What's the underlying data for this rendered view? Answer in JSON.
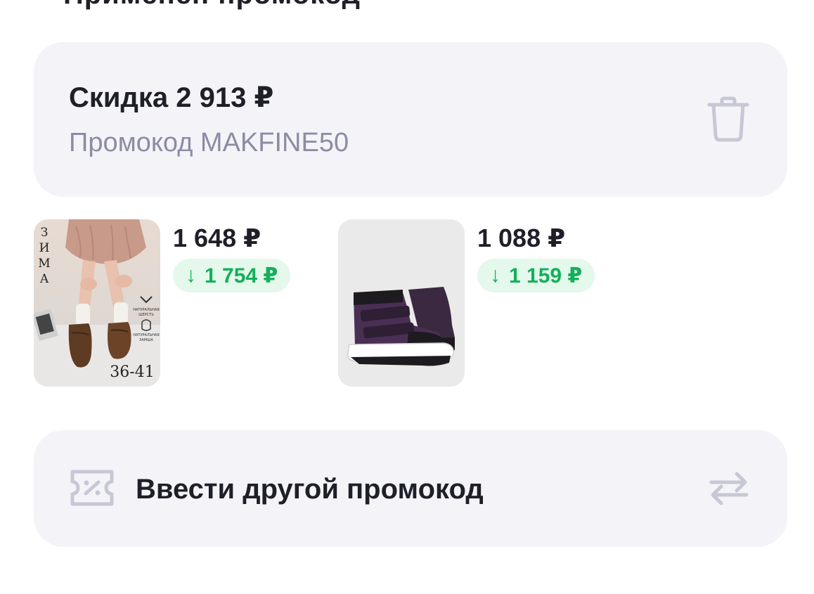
{
  "header": {
    "title_partial": "Применен промокод"
  },
  "promo": {
    "discount_label": "Скидка 2 913 ₽",
    "code_label": "Промокод MAKFINE50",
    "delete_icon": "trash-icon"
  },
  "products": [
    {
      "price": "1 648 ₽",
      "saving": "1 754 ₽",
      "saving_arrow": "↓",
      "image_text": {
        "season": "ЗИМА",
        "sizes": "36-41",
        "badge_wool": "НАТУРАЛЬНАЯ ШЕРСТЬ",
        "badge_suede": "НАТУРАЛЬНАЯ ЗАМША"
      }
    },
    {
      "price": "1 088 ₽",
      "saving": "1 159 ₽",
      "saving_arrow": "↓"
    }
  ],
  "enter_promo": {
    "label": "Ввести другой промокод",
    "icon": "discount-ticket-icon",
    "action_icon": "swap-icon"
  },
  "colors": {
    "card_bg": "#f4f4f8",
    "text_primary": "#1f1f29",
    "text_secondary": "#8c8ca4",
    "saving_text": "#13b05a",
    "saving_bg": "#e4f8ec",
    "icon_muted": "#c7c7d6"
  }
}
